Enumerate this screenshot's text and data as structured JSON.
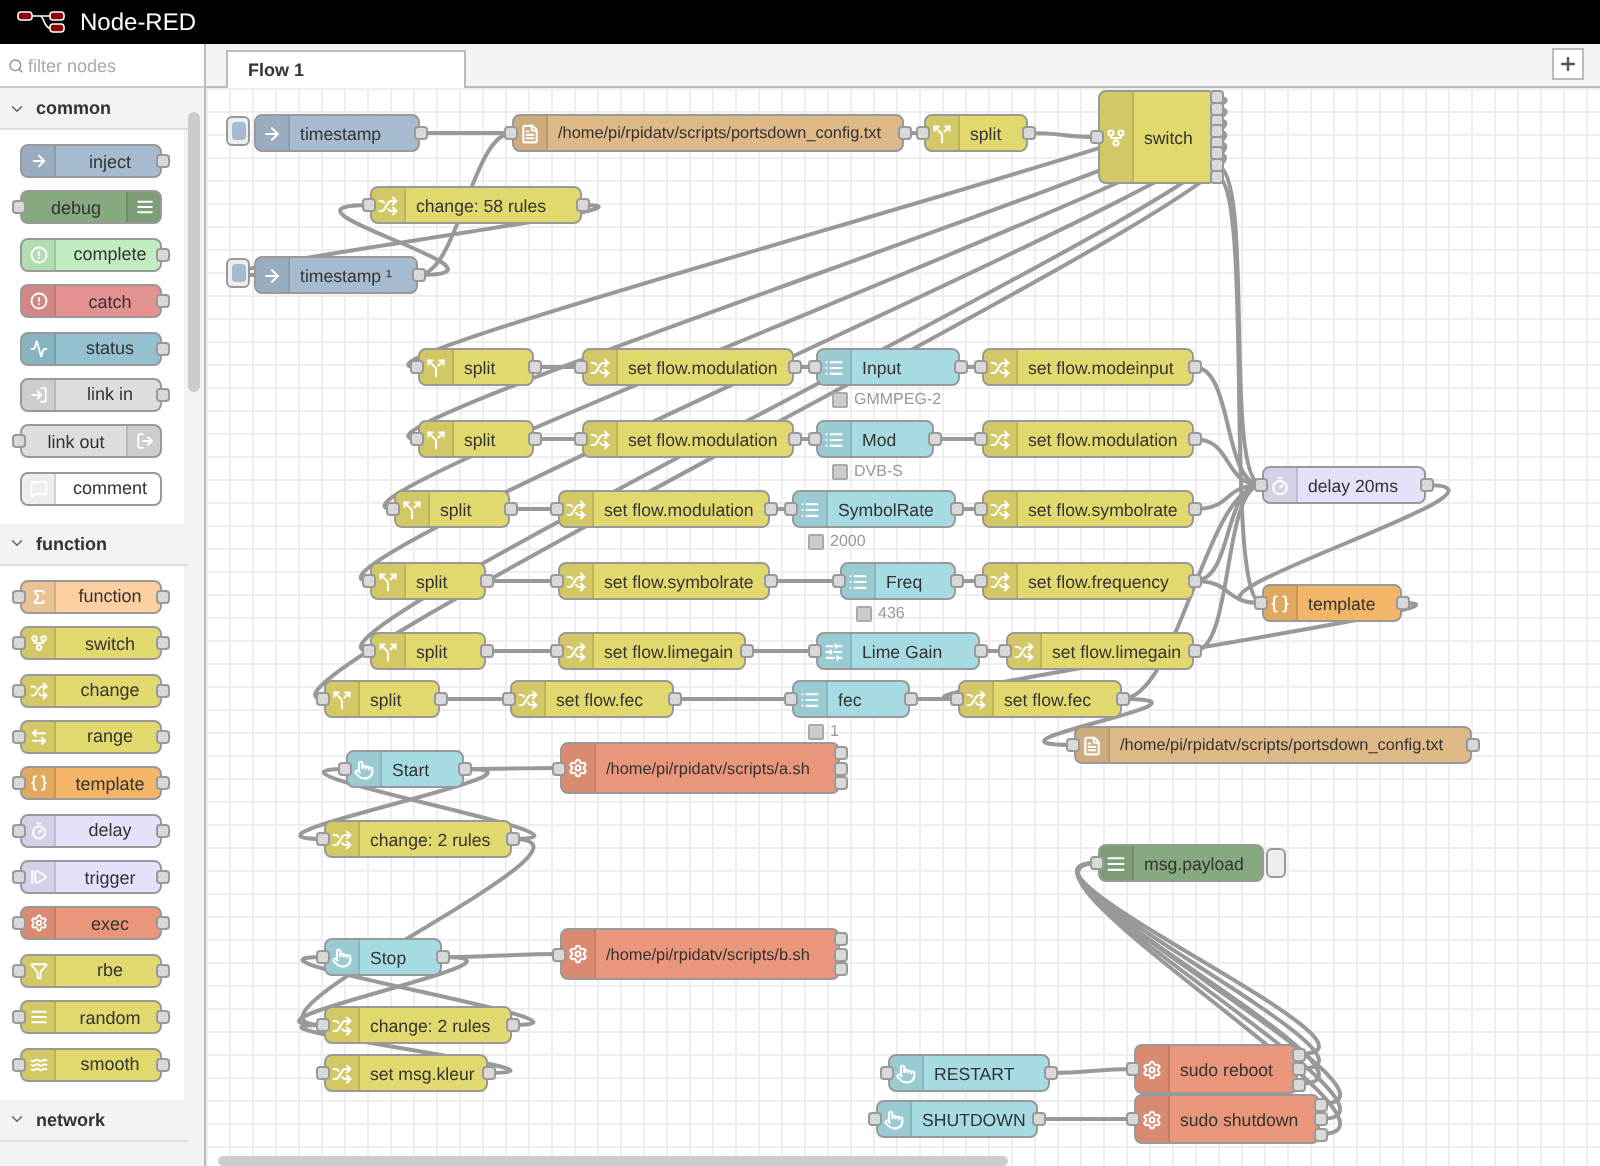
{
  "app": {
    "title": "Node-RED"
  },
  "palette": {
    "search": {
      "placeholder": "filter nodes"
    },
    "categories": [
      {
        "name": "common",
        "expanded": true,
        "nodes": [
          {
            "label": "inject",
            "kind": "inject"
          },
          {
            "label": "debug",
            "kind": "debug"
          },
          {
            "label": "complete",
            "kind": "complete"
          },
          {
            "label": "catch",
            "kind": "catch"
          },
          {
            "label": "status",
            "kind": "status"
          },
          {
            "label": "link in",
            "kind": "link-in"
          },
          {
            "label": "link out",
            "kind": "link-out"
          },
          {
            "label": "comment",
            "kind": "comment"
          }
        ]
      },
      {
        "name": "function",
        "expanded": true,
        "nodes": [
          {
            "label": "function",
            "kind": "function"
          },
          {
            "label": "switch",
            "kind": "switch"
          },
          {
            "label": "change",
            "kind": "change"
          },
          {
            "label": "range",
            "kind": "range"
          },
          {
            "label": "template",
            "kind": "template"
          },
          {
            "label": "delay",
            "kind": "delay"
          },
          {
            "label": "trigger",
            "kind": "trigger"
          },
          {
            "label": "exec",
            "kind": "exec"
          },
          {
            "label": "rbe",
            "kind": "rbe"
          },
          {
            "label": "random",
            "kind": "random"
          },
          {
            "label": "smooth",
            "kind": "smooth"
          }
        ]
      },
      {
        "name": "network",
        "expanded": true
      }
    ]
  },
  "workspace": {
    "tabs": [
      {
        "label": "Flow 1",
        "selected": true
      }
    ],
    "nodes": [
      {
        "label": "timestamp",
        "kind": "inject"
      },
      {
        "label": "/home/pi/rpidatv/scripts/portsdown_config.txt",
        "kind": "file"
      },
      {
        "label": "split",
        "kind": "split"
      },
      {
        "label": "switch",
        "kind": "switch"
      },
      {
        "label": "change: 58 rules",
        "kind": "change"
      },
      {
        "label": "timestamp ¹",
        "kind": "inject"
      },
      {
        "label": "split",
        "kind": "split"
      },
      {
        "label": "set flow.modulation",
        "kind": "change"
      },
      {
        "label": "Input",
        "kind": "dropdown",
        "status": "GMMPEG-2"
      },
      {
        "label": "set flow.modeinput",
        "kind": "change"
      },
      {
        "label": "split",
        "kind": "split"
      },
      {
        "label": "set flow.modulation",
        "kind": "change"
      },
      {
        "label": "Mod",
        "kind": "dropdown",
        "status": "DVB-S"
      },
      {
        "label": "set flow.modulation",
        "kind": "change"
      },
      {
        "label": "split",
        "kind": "split"
      },
      {
        "label": "set flow.modulation",
        "kind": "change"
      },
      {
        "label": "SymbolRate",
        "kind": "dropdown",
        "status": "2000"
      },
      {
        "label": "set flow.symbolrate",
        "kind": "change"
      },
      {
        "label": "split",
        "kind": "split"
      },
      {
        "label": "set flow.symbolrate",
        "kind": "change"
      },
      {
        "label": "Freq",
        "kind": "dropdown",
        "status": "436"
      },
      {
        "label": "set flow.frequency",
        "kind": "change"
      },
      {
        "label": "split",
        "kind": "split"
      },
      {
        "label": "set flow.limegain",
        "kind": "change"
      },
      {
        "label": "Lime Gain",
        "kind": "slider"
      },
      {
        "label": "set flow.limegain",
        "kind": "change"
      },
      {
        "label": "split",
        "kind": "split"
      },
      {
        "label": "set flow.fec",
        "kind": "change"
      },
      {
        "label": "fec",
        "kind": "dropdown",
        "status": "1"
      },
      {
        "label": "set flow.fec",
        "kind": "change"
      },
      {
        "label": "delay 20ms",
        "kind": "delay"
      },
      {
        "label": "template",
        "kind": "template"
      },
      {
        "label": "/home/pi/rpidatv/scripts/portsdown_config.txt",
        "kind": "file"
      },
      {
        "label": "Start",
        "kind": "button"
      },
      {
        "label": "/home/pi/rpidatv/scripts/a.sh",
        "kind": "exec"
      },
      {
        "label": "change: 2 rules",
        "kind": "change"
      },
      {
        "label": "Stop",
        "kind": "button"
      },
      {
        "label": "/home/pi/rpidatv/scripts/b.sh",
        "kind": "exec"
      },
      {
        "label": "change: 2 rules",
        "kind": "change"
      },
      {
        "label": "set msg.kleur",
        "kind": "change"
      },
      {
        "label": "msg.payload",
        "kind": "debug"
      },
      {
        "label": "RESTART",
        "kind": "button"
      },
      {
        "label": "SHUTDOWN",
        "kind": "button"
      },
      {
        "label": "sudo reboot",
        "kind": "exec"
      },
      {
        "label": "sudo shutdown",
        "kind": "exec"
      }
    ]
  }
}
